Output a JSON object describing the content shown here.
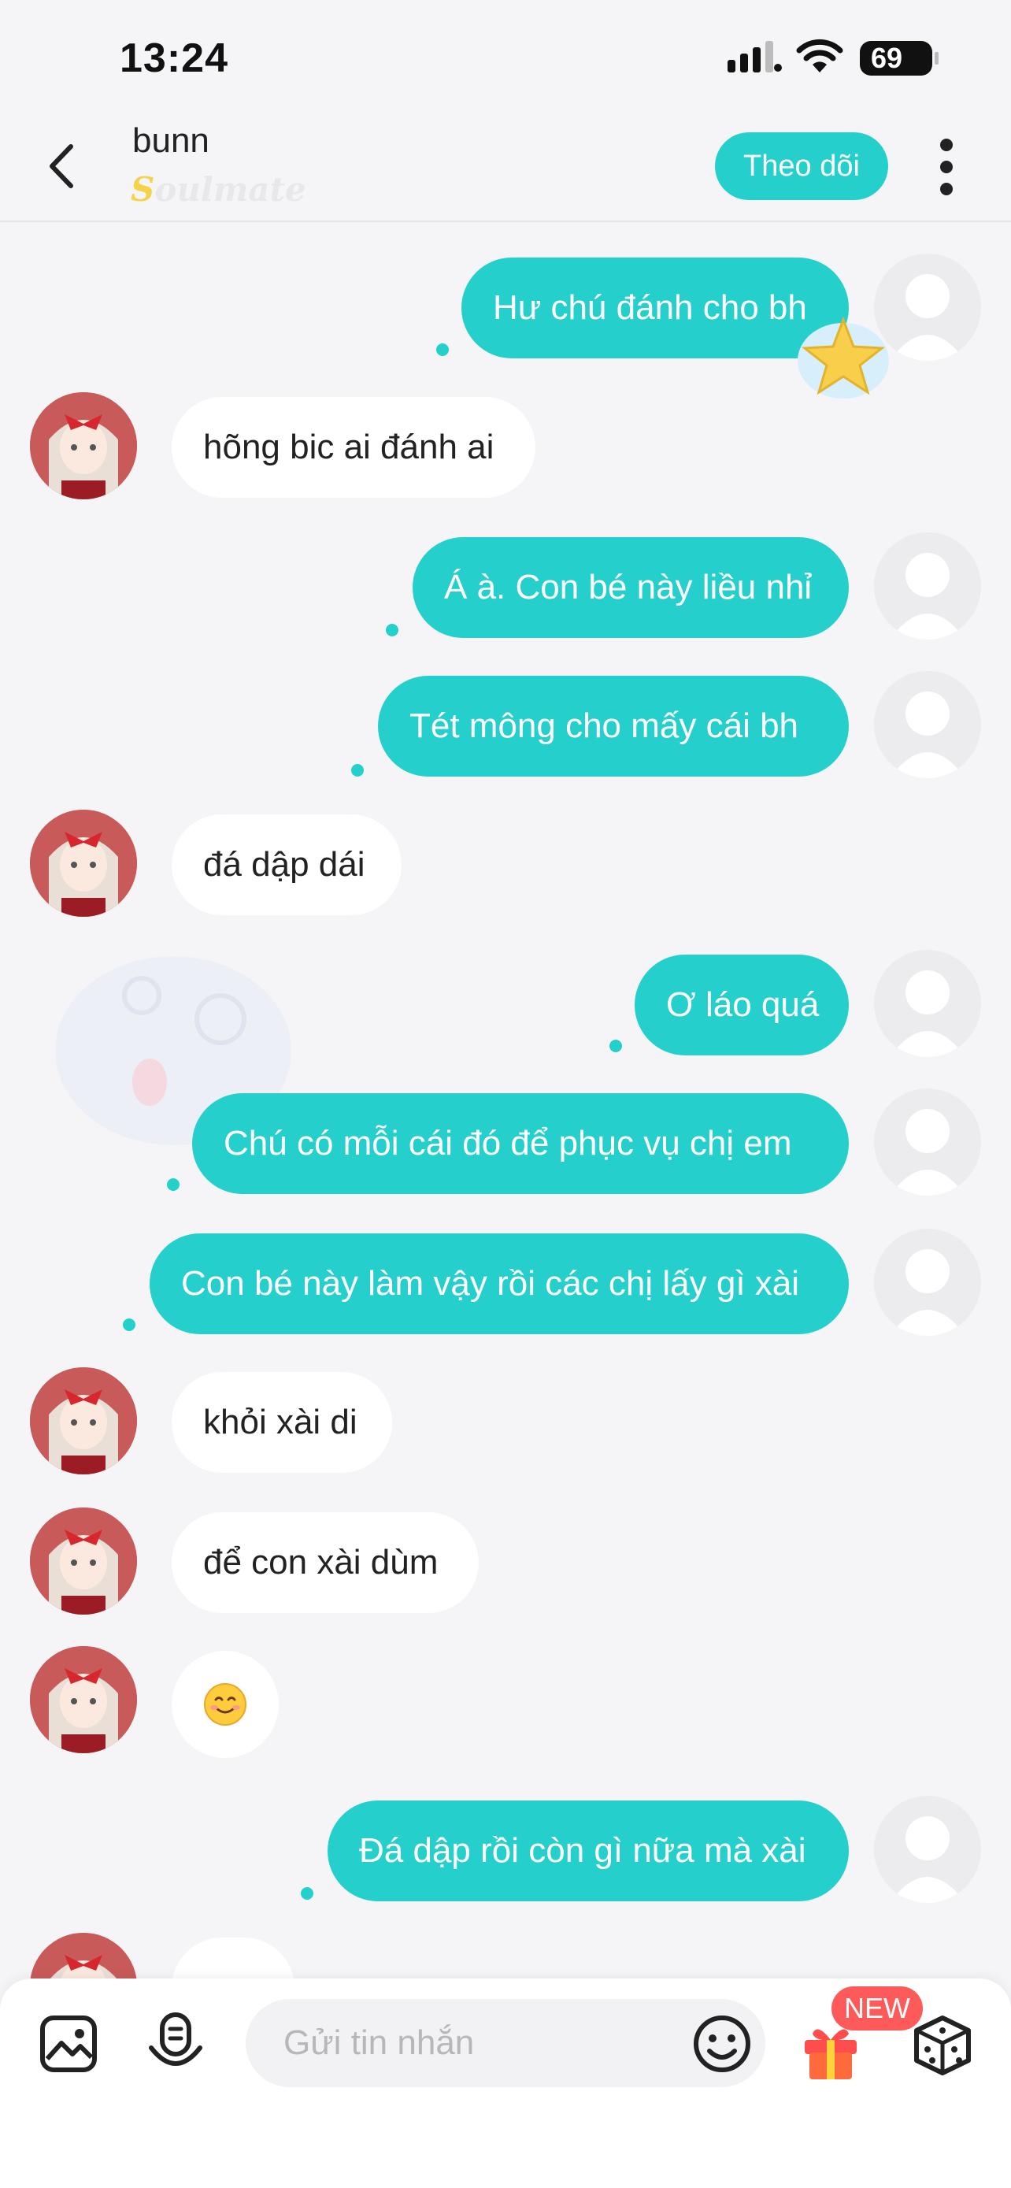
{
  "status_bar": {
    "time": "13:24",
    "battery": "69"
  },
  "header": {
    "contact_name": "bunn",
    "badge": "Soulmate",
    "follow_label": "Theo dõi"
  },
  "messages": [
    {
      "direction": "out",
      "text": "Hư chú đánh cho bh"
    },
    {
      "direction": "in",
      "text": "hõng bic ai đánh ai"
    },
    {
      "direction": "out",
      "text": "Á à. Con bé này liều nhỉ"
    },
    {
      "direction": "out",
      "text": "Tét mông cho mấy cái bh"
    },
    {
      "direction": "in",
      "text": "đá dập dái"
    },
    {
      "direction": "out",
      "text": "Ơ láo quá"
    },
    {
      "direction": "out",
      "text": "Chú có mỗi cái đó để phục vụ chị em"
    },
    {
      "direction": "out",
      "text": "Con bé này làm vậy rồi các chị lấy gì xài"
    },
    {
      "direction": "in",
      "text": "khỏi xài di"
    },
    {
      "direction": "in",
      "text": "để con xài dùm"
    },
    {
      "direction": "in",
      "text": "😊"
    },
    {
      "direction": "out",
      "text": "Đá dập rồi còn gì nữa mà xài"
    }
  ],
  "input_bar": {
    "placeholder": "Gửi tin nhắn",
    "new_badge": "NEW",
    "icons": [
      "image-icon",
      "voice-icon",
      "emoji-icon",
      "gift-icon",
      "dice-icon"
    ]
  },
  "colors": {
    "accent": "#25d0cc",
    "incoming_bubble": "#ffffff",
    "background": "#f5f5f7",
    "badge_red": "#ff5a5a"
  }
}
